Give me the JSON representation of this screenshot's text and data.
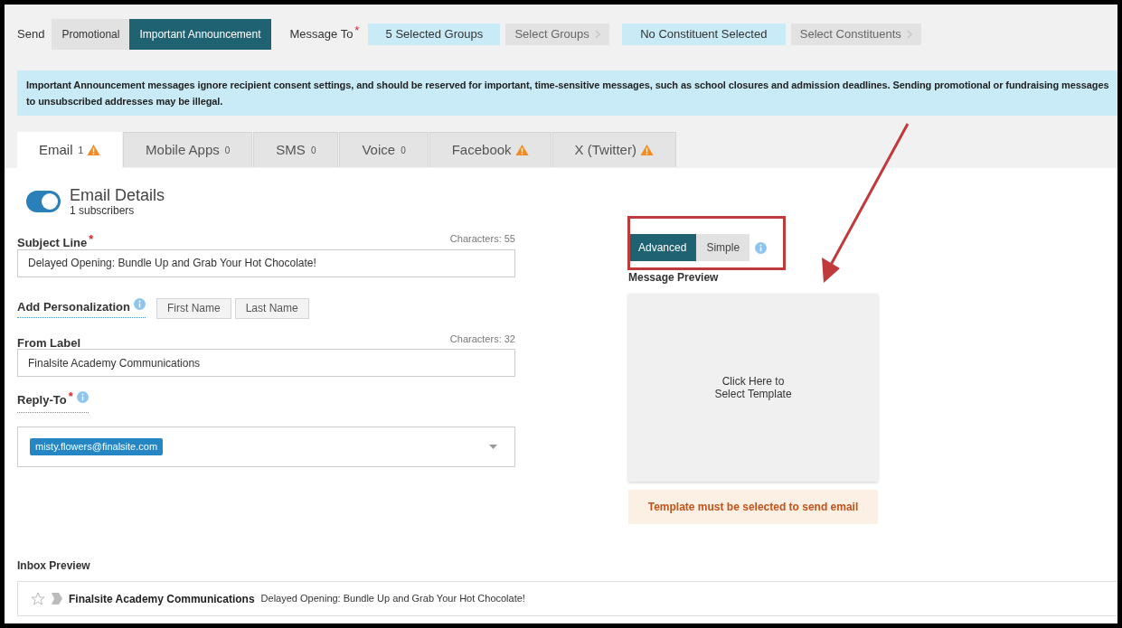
{
  "send": {
    "label": "Send",
    "options": [
      {
        "label": "Promotional",
        "selected": false
      },
      {
        "label": "Important Announcement",
        "selected": true
      }
    ]
  },
  "message_to": {
    "label": "Message To",
    "required_mark": "*",
    "groups_value": "5 Selected Groups",
    "groups_button": "Select Groups",
    "constituents_value": "No Constituent Selected",
    "constituents_button": "Select Constituents"
  },
  "notice": "Important Announcement messages ignore recipient consent settings, and should be reserved for important, time-sensitive messages, such as school closures and admission deadlines. Sending promotional or fundraising messages to unsubscribed addresses may be illegal.",
  "tabs": [
    {
      "label": "Email",
      "count": "1",
      "warning": true,
      "selected": true
    },
    {
      "label": "Mobile Apps",
      "count": "0",
      "warning": false,
      "selected": false
    },
    {
      "label": "SMS",
      "count": "0",
      "warning": false,
      "selected": false
    },
    {
      "label": "Voice",
      "count": "0",
      "warning": false,
      "selected": false
    },
    {
      "label": "Facebook",
      "warning": true,
      "selected": false
    },
    {
      "label": "X (Twitter)",
      "warning": true,
      "selected": false
    }
  ],
  "details": {
    "on": true,
    "title": "Email Details",
    "subtitle": "1 subscribers"
  },
  "subject": {
    "label": "Subject Line",
    "required_mark": "*",
    "counter": "Characters: 55",
    "value": "Delayed Opening: Bundle Up and Grab Your Hot Chocolate!"
  },
  "personalization": {
    "label": "Add Personalization",
    "buttons": [
      "First Name",
      "Last Name"
    ]
  },
  "from_label": {
    "label": "From Label",
    "counter": "Characters: 32",
    "value": "Finalsite Academy Communications"
  },
  "reply_to": {
    "label": "Reply-To",
    "required_mark": "*",
    "tags": [
      "misty.flowers@finalsite.com"
    ]
  },
  "editor_mode": [
    {
      "label": "Advanced",
      "selected": true
    },
    {
      "label": "Simple",
      "selected": false
    }
  ],
  "message_preview": {
    "label": "Message Preview",
    "placeholder_lines": [
      "Click Here to",
      "Select Template"
    ],
    "warning": "Template must be selected to send email"
  },
  "inbox_preview": {
    "label": "Inbox Preview",
    "sender": "Finalsite Academy Communications",
    "subject": "Delayed Opening: Bundle Up and Grab Your Hot Chocolate!",
    "starred": false
  }
}
